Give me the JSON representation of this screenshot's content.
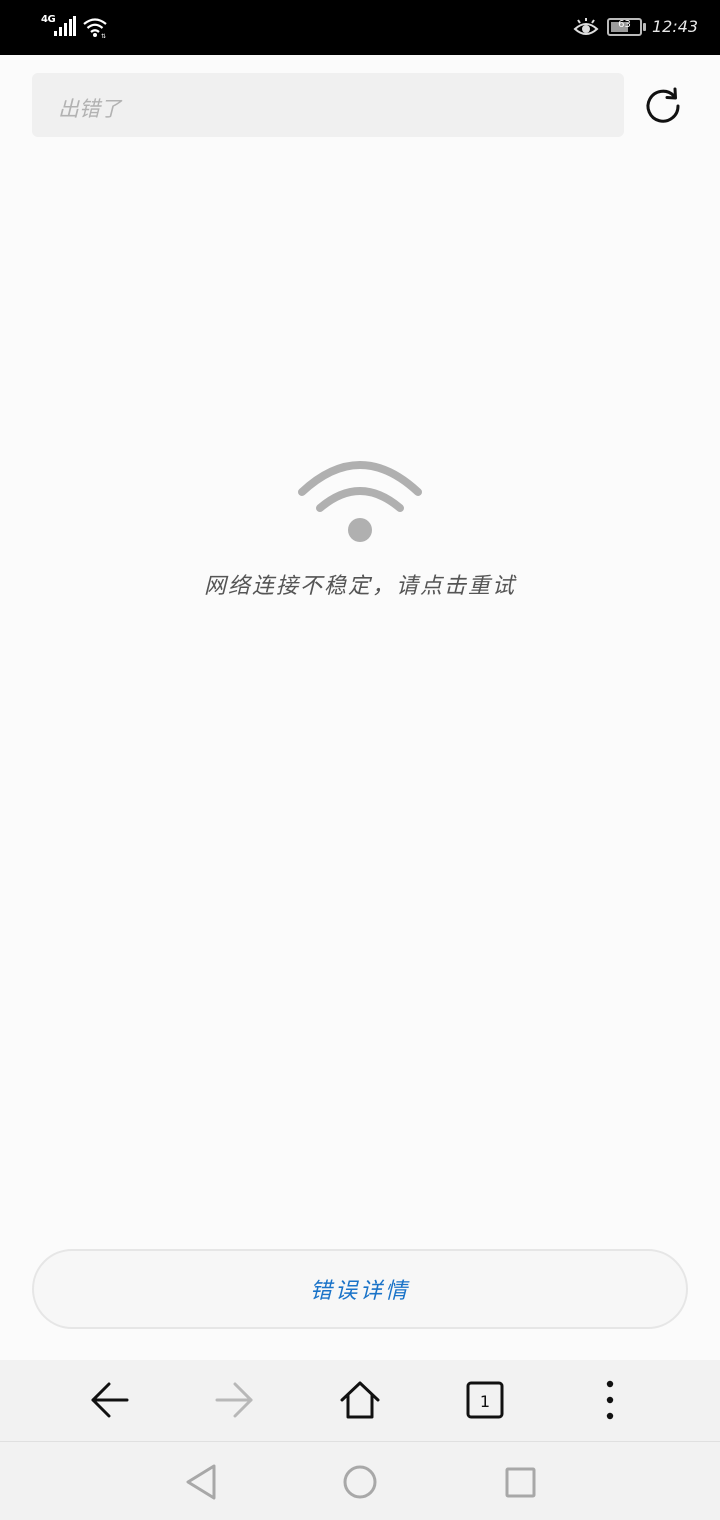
{
  "status_bar": {
    "network_type": "4G",
    "time": "12:43",
    "battery": {
      "text": "63",
      "level_percent": 63
    }
  },
  "address_bar": {
    "text": "出错了"
  },
  "error": {
    "message": "网络连接不稳定，请点击重试"
  },
  "details_button": {
    "label": "错误详情"
  },
  "toolbar": {
    "icons": [
      "back-icon",
      "forward-icon",
      "home-icon",
      "tabs-icon",
      "more-icon"
    ],
    "tab_count": "1"
  },
  "system_nav": {
    "icons": [
      "back-triangle-icon",
      "home-circle-icon",
      "recents-square-icon"
    ]
  },
  "colors": {
    "status_bar_bg": "#000000",
    "page_bg": "#fbfbfb",
    "link_blue": "#1a73c8",
    "icon_gray": "#b0b0b0"
  }
}
